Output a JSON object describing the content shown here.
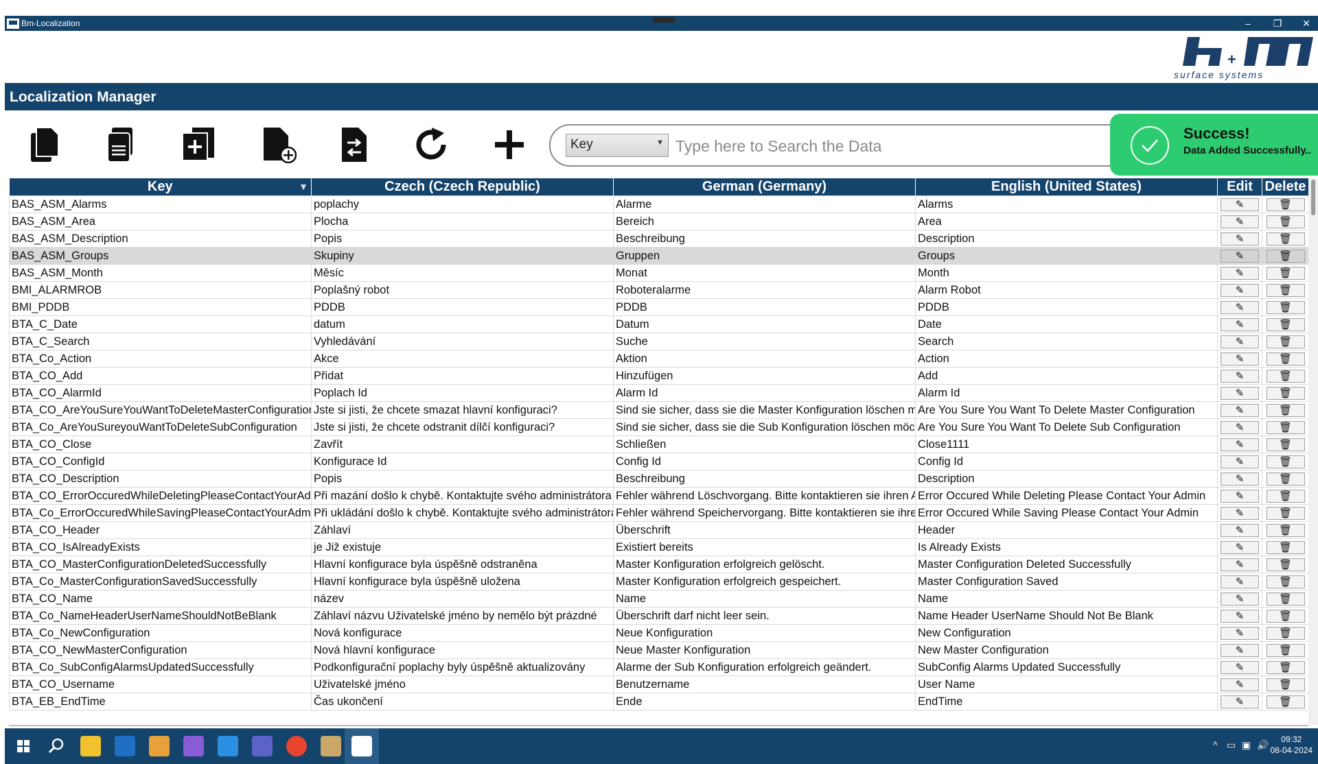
{
  "window": {
    "title": "Bm-Localization",
    "minimize": "–",
    "restore": "❐",
    "close": "✕"
  },
  "logo": {
    "tagline": "surface systems"
  },
  "header": {
    "title": "Localization Manager"
  },
  "toolbar": {
    "tools": [
      "documents-icon",
      "document-list-icon",
      "add-copy-icon",
      "document-add-icon",
      "document-exchange-icon",
      "refresh-icon",
      "plus-icon"
    ]
  },
  "search": {
    "selected_column": "Key",
    "placeholder": "Type here to Search the Data"
  },
  "toast": {
    "title": "Success!",
    "message": "Data Added Successfully..",
    "color": "#2ecc71"
  },
  "table": {
    "columns": [
      "Key",
      "Czech (Czech Republic)",
      "German (Germany)",
      "English (United States)",
      "Edit",
      "Delete"
    ],
    "edit_icon": "✎",
    "delete_icon": "🗑",
    "selected_row": 3,
    "rows": [
      [
        "BAS_ASM_Alarms",
        "poplachy",
        "Alarme",
        "Alarms"
      ],
      [
        "BAS_ASM_Area",
        "Plocha",
        "Bereich",
        "Area"
      ],
      [
        "BAS_ASM_Description",
        "Popis",
        "Beschreibung",
        "Description"
      ],
      [
        "BAS_ASM_Groups",
        "Skupiny",
        "Gruppen",
        "Groups"
      ],
      [
        "BAS_ASM_Month",
        "Měsíc",
        "Monat",
        "Month"
      ],
      [
        "BMI_ALARMROB",
        "Poplašný robot",
        "Roboteralarme",
        "Alarm Robot"
      ],
      [
        "BMI_PDDB",
        "PDDB",
        "PDDB",
        "PDDB"
      ],
      [
        "BTA_C_Date",
        "datum",
        "Datum",
        "Date"
      ],
      [
        "BTA_C_Search",
        "Vyhledávání",
        "Suche",
        "Search"
      ],
      [
        "BTA_Co_Action",
        "Akce",
        "Aktion",
        "Action"
      ],
      [
        "BTA_CO_Add",
        "Přidat",
        "Hinzufügen",
        "Add"
      ],
      [
        "BTA_CO_AlarmId",
        "Poplach Id",
        "Alarm Id",
        "Alarm Id"
      ],
      [
        "BTA_CO_AreYouSureYouWantToDeleteMasterConfiguration",
        "Jste si jisti, že chcete smazat hlavní konfiguraci?",
        "Sind sie sicher, dass sie die Master Konfiguration löschen möchten?",
        "Are You Sure You Want To Delete Master Configuration"
      ],
      [
        "BTA_Co_AreYouSureyouWantToDeleteSubConfiguration",
        "Jste si jisti, že chcete odstranit dílčí konfiguraci?",
        "Sind sie sicher, dass sie die Sub Konfiguration löschen möchten?",
        "Are You Sure You Want To Delete Sub Configuration"
      ],
      [
        "BTA_CO_Close",
        "Zavřít",
        "Schließen",
        "Close1111"
      ],
      [
        "BTA_CO_ConfigId",
        "Konfigurace Id",
        "Config Id",
        "Config Id"
      ],
      [
        "BTA_CO_Description",
        "Popis",
        "Beschreibung",
        "Description"
      ],
      [
        "BTA_CO_ErrorOccuredWhileDeletingPleaseContactYourAdmin",
        "Při mazání došlo k chybě. Kontaktujte svého administrátora",
        "Fehler während Löschvorgang. Bitte kontaktieren sie ihren Administrator",
        "Error Occured While Deleting Please Contact Your Admin"
      ],
      [
        "BTA_Co_ErrorOccuredWhileSavingPleaseContactYourAdmin",
        "Při ukládání došlo k chybě. Kontaktujte svého administrátora",
        "Fehler während Speichervorgang. Bitte kontaktieren sie ihren Administrator",
        "Error Occured While Saving Please Contact Your Admin"
      ],
      [
        "BTA_CO_Header",
        "Záhlaví",
        "Überschrift",
        "Header"
      ],
      [
        "BTA_CO_IsAlreadyExists",
        "je Již existuje",
        "Existiert bereits",
        "Is Already Exists"
      ],
      [
        "BTA_CO_MasterConfigurationDeletedSuccessfully",
        "Hlavní konfigurace byla úspěšně odstraněna",
        "Master Konfiguration erfolgreich gelöscht.",
        "Master Configuration Deleted Successfully"
      ],
      [
        "BTA_Co_MasterConfigurationSavedSuccessfully",
        "Hlavní konfigurace byla úspěšně uložena",
        "Master Konfiguration erfolgreich gespeichert.",
        "Master Configuration Saved"
      ],
      [
        "BTA_CO_Name",
        "název",
        "Name",
        "Name"
      ],
      [
        "BTA_Co_NameHeaderUserNameShouldNotBeBlank",
        "Záhlaví názvu Uživatelské jméno by nemělo být prázdné",
        "Überschrift darf nicht leer sein.",
        "Name Header UserName Should Not Be Blank"
      ],
      [
        "BTA_Co_NewConfiguration",
        "Nová konfigurace",
        "Neue Konfiguration",
        "New Configuration"
      ],
      [
        "BTA_CO_NewMasterConfiguration",
        "Nová hlavní konfigurace",
        "Neue Master Konfiguration",
        "New Master Configuration"
      ],
      [
        "BTA_Co_SubConfigAlarmsUpdatedSuccessfully",
        "Podkonfigurační poplachy byly úspěšně aktualizovány",
        "Alarme der Sub Konfiguration erfolgreich geändert.",
        "SubConfig Alarms Updated Successfully"
      ],
      [
        "BTA_CO_Username",
        "Uživatelské jméno",
        "Benutzername",
        "User Name"
      ],
      [
        "BTA_EB_EndTime",
        "Čas ukončení",
        "Ende",
        "EndTime"
      ]
    ]
  },
  "taskbar": {
    "apps": [
      "windows-start-icon",
      "search-icon",
      "file-explorer-icon",
      "outlook-icon",
      "app-icon",
      "visual-studio-icon",
      "vscode-icon",
      "teams-icon",
      "chrome-icon",
      "paint-icon",
      "bm-localization-icon"
    ],
    "time": "09:32",
    "date": "08-04-2024",
    "tray": [
      "^",
      "▭",
      "▣",
      "🔊"
    ]
  }
}
